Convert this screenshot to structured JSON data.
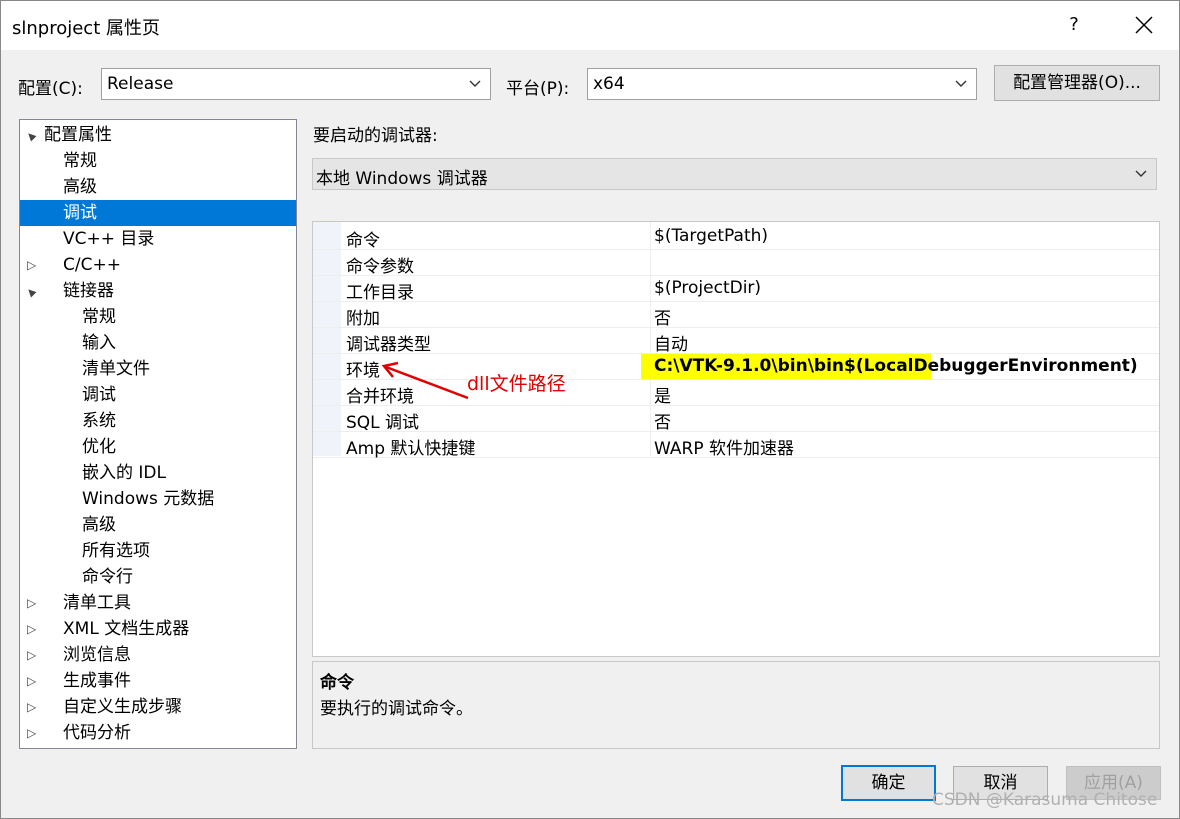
{
  "window": {
    "title": "slnproject 属性页",
    "help_label": "?"
  },
  "toolbar": {
    "config_label": "配置(C):",
    "config_value": "Release",
    "platform_label": "平台(P):",
    "platform_value": "x64",
    "config_manager_label": "配置管理器(O)..."
  },
  "tree": {
    "items": [
      {
        "label": "配置属性",
        "expander": "▲"
      },
      {
        "label": "常规",
        "expander": ""
      },
      {
        "label": "高级",
        "expander": ""
      },
      {
        "label": "调试",
        "expander": "",
        "selected": true
      },
      {
        "label": "VC++ 目录",
        "expander": ""
      },
      {
        "label": "C/C++",
        "expander": "▷"
      },
      {
        "label": "链接器",
        "expander": "▲"
      },
      {
        "label": "常规",
        "expander": ""
      },
      {
        "label": "输入",
        "expander": ""
      },
      {
        "label": "清单文件",
        "expander": ""
      },
      {
        "label": "调试",
        "expander": ""
      },
      {
        "label": "系统",
        "expander": ""
      },
      {
        "label": "优化",
        "expander": ""
      },
      {
        "label": "嵌入的 IDL",
        "expander": ""
      },
      {
        "label": "Windows 元数据",
        "expander": ""
      },
      {
        "label": "高级",
        "expander": ""
      },
      {
        "label": "所有选项",
        "expander": ""
      },
      {
        "label": "命令行",
        "expander": ""
      },
      {
        "label": "清单工具",
        "expander": "▷"
      },
      {
        "label": "XML 文档生成器",
        "expander": "▷"
      },
      {
        "label": "浏览信息",
        "expander": "▷"
      },
      {
        "label": "生成事件",
        "expander": "▷"
      },
      {
        "label": "自定义生成步骤",
        "expander": "▷"
      },
      {
        "label": "代码分析",
        "expander": "▷"
      }
    ]
  },
  "debugger": {
    "label": "要启动的调试器:",
    "value": "本地 Windows 调试器"
  },
  "properties": [
    {
      "name": "命令",
      "value": "$(TargetPath)"
    },
    {
      "name": "命令参数",
      "value": ""
    },
    {
      "name": "工作目录",
      "value": "$(ProjectDir)"
    },
    {
      "name": "附加",
      "value": "否"
    },
    {
      "name": "调试器类型",
      "value": "自动"
    },
    {
      "name": "环境",
      "value": "C:\\VTK-9.1.0\\bin\\bin$(LocalDebuggerEnvironment)",
      "bold": true,
      "highlight_color": "#ffff00"
    },
    {
      "name": "合并环境",
      "value": "是"
    },
    {
      "name": "SQL 调试",
      "value": "否"
    },
    {
      "name": "Amp 默认快捷键",
      "value": "WARP 软件加速器"
    }
  ],
  "annotation": {
    "text": "dll文件路径",
    "color": "#e00000"
  },
  "description": {
    "title": "命令",
    "text": "要执行的调试命令。"
  },
  "buttons": {
    "ok": "确定",
    "cancel": "取消",
    "apply": "应用(A)"
  },
  "watermark": "CSDN @Karasuma Chitose",
  "colors": {
    "selection": "#0078d7",
    "highlight": "#ffff00"
  }
}
